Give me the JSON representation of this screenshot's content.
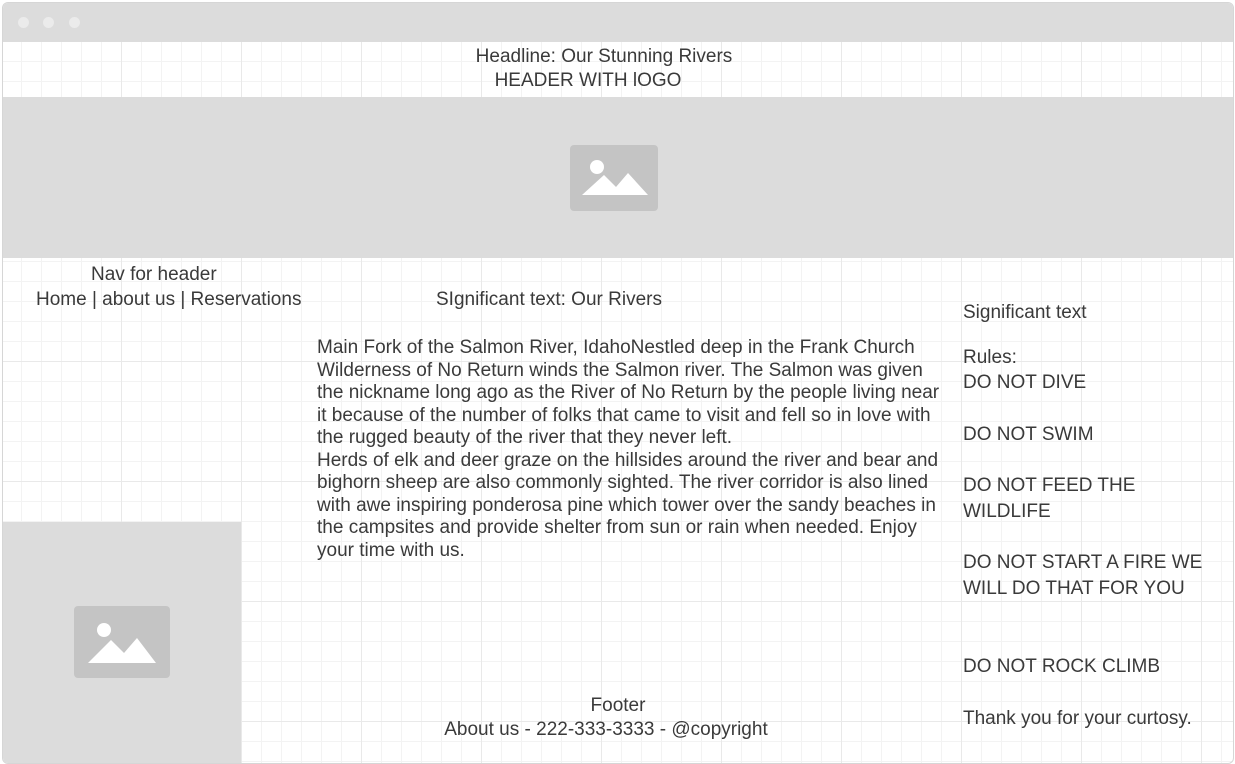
{
  "header": {
    "headline": "Headline: Our Stunning Rivers",
    "logo_text": "HEADER WITH lOGO"
  },
  "hero_image": {
    "icon": "image-placeholder-icon"
  },
  "nav": {
    "label": "Nav for header",
    "links": [
      "Home | about us | Reservations"
    ]
  },
  "main": {
    "heading": "SIgnificant text: Our Rivers",
    "paragraph1": "Main Fork of the Salmon River, IdahoNestled deep in the Frank Church Wilderness of No Return winds the Salmon river. The Salmon was given the nickname long ago as the River of No Return by the people living near it because of the number of folks that came to visit and fell so in love with the rugged beauty of the river that they never left.",
    "paragraph2": "Herds of elk and deer graze on the hillsides around the river and bear and bighorn sheep are also commonly sighted. The river corridor is also lined with awe inspiring ponderosa pine which tower over the sandy beaches in the campsites and provide shelter from sun or rain when needed. Enjoy your time with us."
  },
  "sidebar": {
    "heading": "Significant text",
    "rules_label": "Rules:",
    "rules": [
      "DO NOT DIVE",
      "DO NOT SWIM",
      "DO NOT FEED THE WILDLIFE",
      "DO NOT START A FIRE WE WILL DO THAT FOR YOU",
      "DO NOT ROCK CLIMB"
    ],
    "closing": "Thank you for your curtosy."
  },
  "side_image": {
    "icon": "image-placeholder-icon"
  },
  "footer": {
    "label": "Footer",
    "text": "About us - 222-333-3333 - @copyright"
  }
}
